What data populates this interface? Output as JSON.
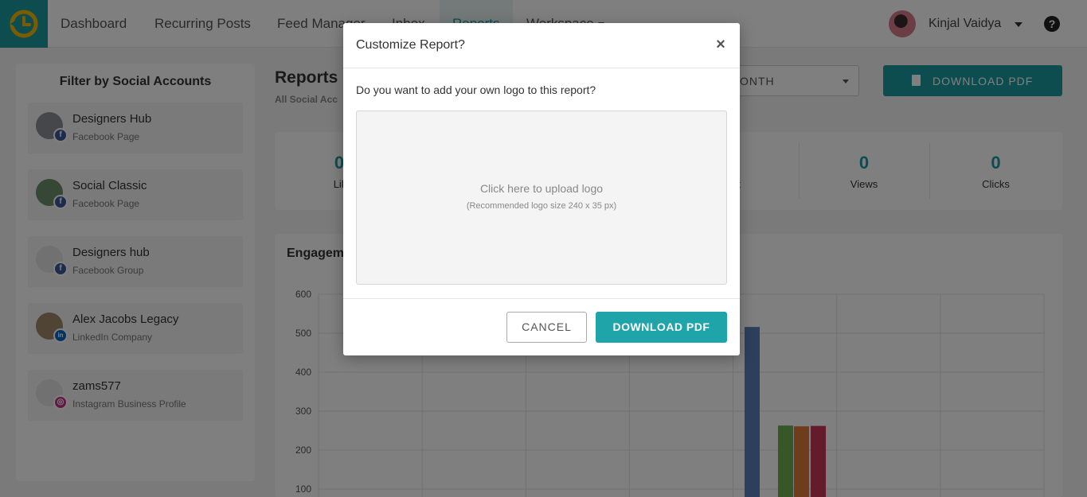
{
  "nav": {
    "items": [
      {
        "label": "Dashboard"
      },
      {
        "label": "Recurring Posts"
      },
      {
        "label": "Feed Manager"
      },
      {
        "label": "Inbox"
      },
      {
        "label": "Reports"
      },
      {
        "label": "Workspace"
      }
    ],
    "active": "Reports",
    "user_name": "Kinjal Vaidya",
    "help_label": "?"
  },
  "sidebar": {
    "title": "Filter by Social Accounts",
    "accounts": [
      {
        "name": "Designers Hub",
        "type": "Facebook Page",
        "network": "facebook"
      },
      {
        "name": "Social Classic",
        "type": "Facebook Page",
        "network": "facebook"
      },
      {
        "name": "Designers hub",
        "type": "Facebook Group",
        "network": "facebook"
      },
      {
        "name": "Alex Jacobs Legacy",
        "type": "LinkedIn Company",
        "network": "linkedin"
      },
      {
        "name": "zams577",
        "type": "Instagram Business Profile",
        "network": "instagram"
      }
    ]
  },
  "main": {
    "title": "Reports",
    "subtitle": "All Social Acc",
    "period_value": "ONTH",
    "download_label": "DOWNLOAD PDF",
    "stats": [
      {
        "value": "0",
        "label": "Lik"
      },
      {
        "value": "",
        "label": "eet"
      },
      {
        "value": "0",
        "label": "Views"
      },
      {
        "value": "0",
        "label": "Clicks"
      }
    ],
    "chart_title": "Engagem"
  },
  "chart_data": {
    "type": "bar",
    "ylim": [
      0,
      600
    ],
    "yticks": [
      "100",
      "200",
      "300",
      "400",
      "500",
      "600"
    ],
    "grid": true,
    "bars": [
      {
        "value": 516,
        "color": "#5b7fb8"
      },
      {
        "value": 263,
        "color": "#6ab04c"
      },
      {
        "value": 261,
        "color": "#e07b39"
      },
      {
        "value": 262,
        "color": "#c8385a"
      }
    ]
  },
  "modal": {
    "title": "Customize Report?",
    "close_label": "×",
    "question": "Do you want to add your own logo to this report?",
    "upload_text": "Click here to upload logo",
    "upload_hint": "(Recommended logo size 240 x 35 px)",
    "cancel_label": "CANCEL",
    "download_label": "DOWNLOAD PDF"
  },
  "colors": {
    "accent": "#1a9ba1"
  }
}
